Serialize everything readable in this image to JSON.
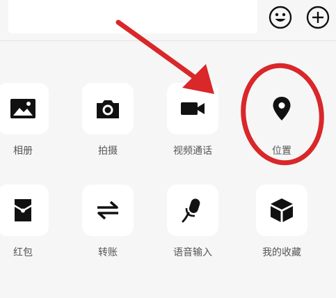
{
  "panel": {
    "items": [
      {
        "label": "相册",
        "icon": "image-icon"
      },
      {
        "label": "拍摄",
        "icon": "camera-icon"
      },
      {
        "label": "视频通话",
        "icon": "video-call-icon"
      },
      {
        "label": "位置",
        "icon": "location-pin-icon"
      },
      {
        "label": "红包",
        "icon": "red-packet-icon"
      },
      {
        "label": "转账",
        "icon": "transfer-icon"
      },
      {
        "label": "语音输入",
        "icon": "microphone-icon"
      },
      {
        "label": "我的收藏",
        "icon": "favorites-cube-icon"
      }
    ]
  },
  "colors": {
    "annotation": "#d9272a",
    "icon": "#111111",
    "label": "#555555",
    "tile": "#ffffff",
    "background": "#f6f6f6"
  }
}
